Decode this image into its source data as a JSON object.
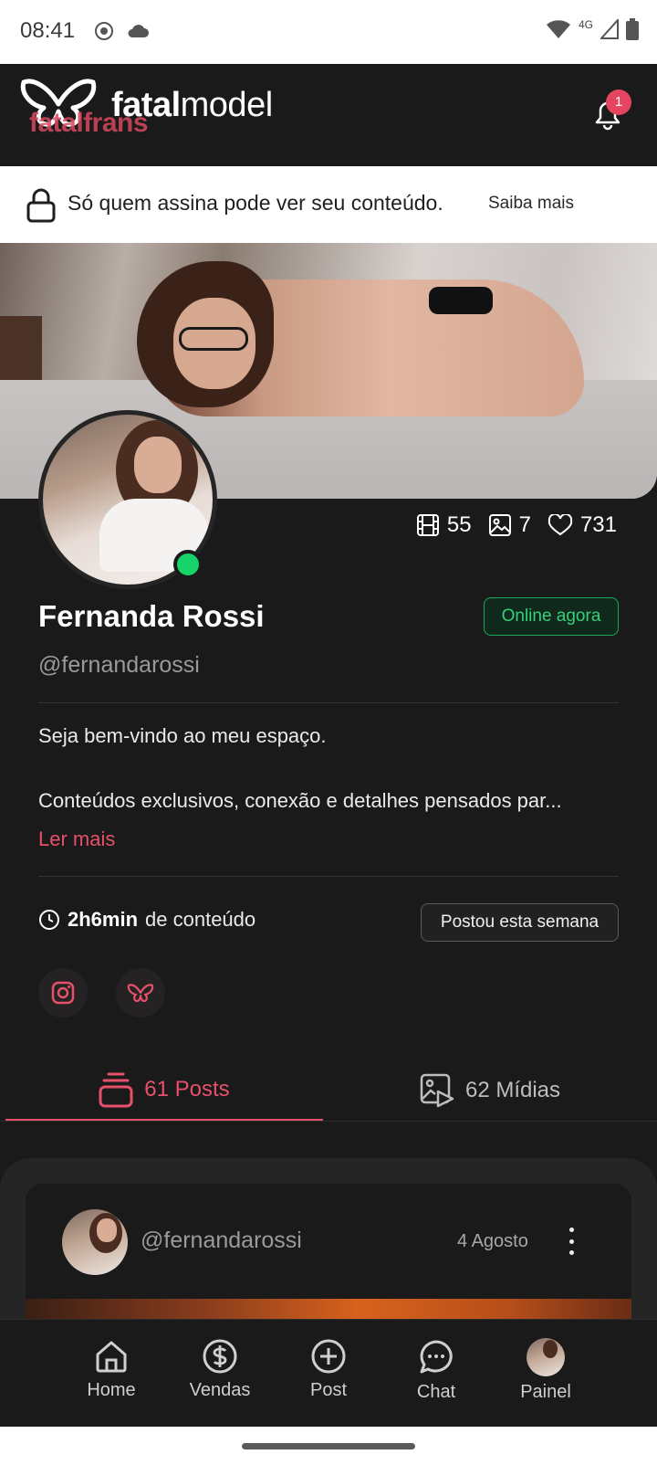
{
  "status_bar": {
    "time": "08:41",
    "network": "4G",
    "icons": [
      "screen-record-icon",
      "cloud-icon",
      "wifi-icon",
      "signal-icon",
      "battery-icon"
    ]
  },
  "header": {
    "logo_bold": "fatal",
    "logo_light": "model",
    "logo_ghost": "fatalfrans",
    "notification_count": "1"
  },
  "lock_banner": {
    "text": "Só quem assina pode ver seu conteúdo.",
    "link": "Saiba mais"
  },
  "profile": {
    "stats": {
      "videos": "55",
      "photos": "7",
      "likes": "731"
    },
    "name": "Fernanda Rossi",
    "status": "Online agora",
    "handle": "@fernandarossi",
    "bio_line1": "Seja bem-vindo ao meu espaço.",
    "bio_line2": "Conteúdos exclusivos, conexão e detalhes pensados par...",
    "read_more": "Ler mais",
    "content_duration": "2h6min",
    "content_suffix": "de conteúdo",
    "activity_badge": "Postou esta semana",
    "social": [
      "instagram-icon",
      "fatalmodel-icon"
    ]
  },
  "tabs": [
    {
      "label": "61 Posts",
      "active": true
    },
    {
      "label": "62 Mídias",
      "active": false
    }
  ],
  "post": {
    "handle": "@fernandarossi",
    "date": "4 Agosto"
  },
  "bottom_nav": [
    {
      "label": "Home",
      "icon": "home-icon"
    },
    {
      "label": "Vendas",
      "icon": "dollar-icon"
    },
    {
      "label": "Post",
      "icon": "plus-circle-icon"
    },
    {
      "label": "Chat",
      "icon": "chat-icon"
    },
    {
      "label": "Painel",
      "icon": "avatar"
    }
  ],
  "colors": {
    "accent": "#e6506a",
    "online": "#16d36a",
    "background": "#1b1a1b"
  }
}
